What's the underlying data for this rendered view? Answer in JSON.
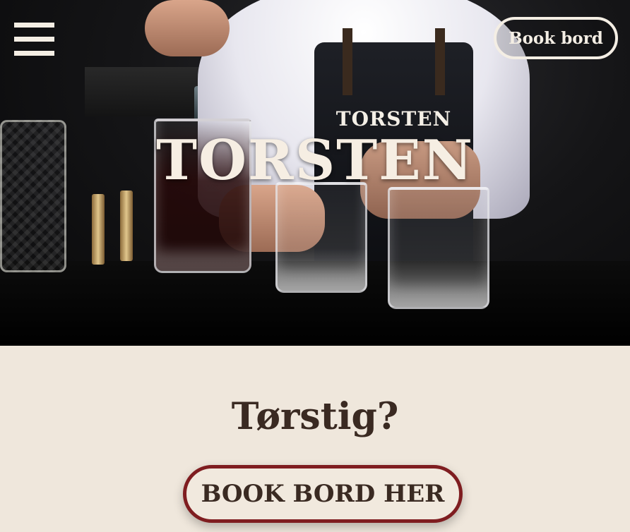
{
  "header": {
    "menu_icon": "hamburger-menu-icon",
    "book_label": "Book bord"
  },
  "hero": {
    "brand": "TORSTEN",
    "apron_brand": "TORSTEN"
  },
  "main": {
    "headline": "Tørstig?",
    "cta_label": "BOOK BORD HER"
  },
  "colors": {
    "cream": "#efe7dc",
    "dark_brown": "#3a2a22",
    "cta_border": "#7f1d20"
  }
}
